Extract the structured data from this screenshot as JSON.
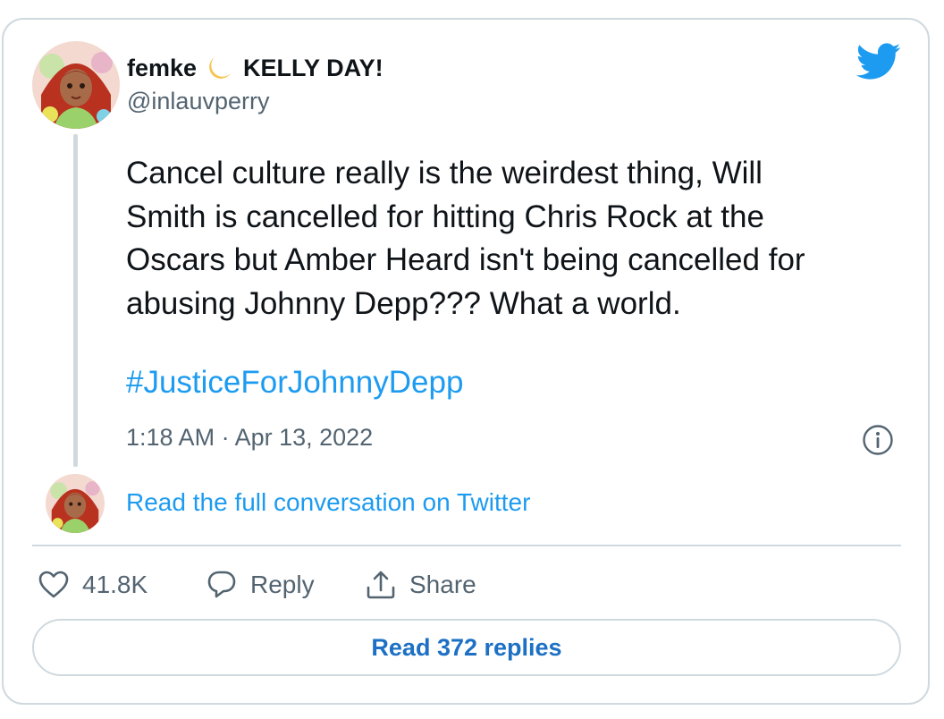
{
  "tweet": {
    "author_name": "femke",
    "author_suffix": "KELLY DAY!",
    "handle": "@inlauvperry",
    "text_lines": [
      "Cancel culture really is the weirdest thing, Will",
      "Smith is cancelled for hitting Chris Rock at the",
      "Oscars but Amber Heard isn't being cancelled for",
      "abusing Johnny Depp??? What a world."
    ],
    "hashtag": "#JusticeForJohnnyDepp",
    "timestamp": "1:18 AM · Apr 13, 2022"
  },
  "conversation": {
    "link_label": "Read the full conversation on Twitter"
  },
  "actions": {
    "like_count": "41.8K",
    "reply_label": "Reply",
    "share_label": "Share"
  },
  "read_replies_label": "Read 372 replies",
  "icons": {
    "brand": "twitter-bird-icon",
    "emoji": "crescent-moon-icon",
    "info": "info-icon",
    "like": "heart-icon",
    "reply": "speech-bubble-icon",
    "share": "share-upload-icon"
  },
  "colors": {
    "accent": "#1d9bf0",
    "text": "#0f1419",
    "muted": "#536471",
    "border": "#cfd9de"
  }
}
